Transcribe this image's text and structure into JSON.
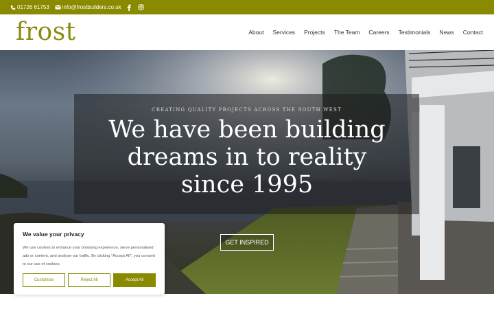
{
  "topbar": {
    "phone": "01726 61753",
    "email": "info@frostbuilders.co.uk"
  },
  "header": {
    "logo": "frost",
    "nav": [
      "About",
      "Services",
      "Projects",
      "The Team",
      "Careers",
      "Testimonials",
      "News",
      "Contact"
    ]
  },
  "hero": {
    "eyebrow": "CREATING QUALITY PROJECTS ACROSS THE SOUTH WEST",
    "headline": "We have been building dreams in to reality since 1995",
    "cta": "GET INSPIRED"
  },
  "cookie": {
    "title": "We value your privacy",
    "text": "We use cookies to enhance your browsing experience, serve personalised ads or content, and analyse our traffic. By clicking \"Accept All\", you consent to our use of cookies.",
    "customise": "Customise",
    "reject": "Reject All",
    "accept": "Accept All"
  },
  "colors": {
    "brand": "#8a8a00",
    "logo": "#8a8a10"
  },
  "icons": [
    "phone-icon",
    "email-icon",
    "facebook-icon",
    "instagram-icon"
  ]
}
